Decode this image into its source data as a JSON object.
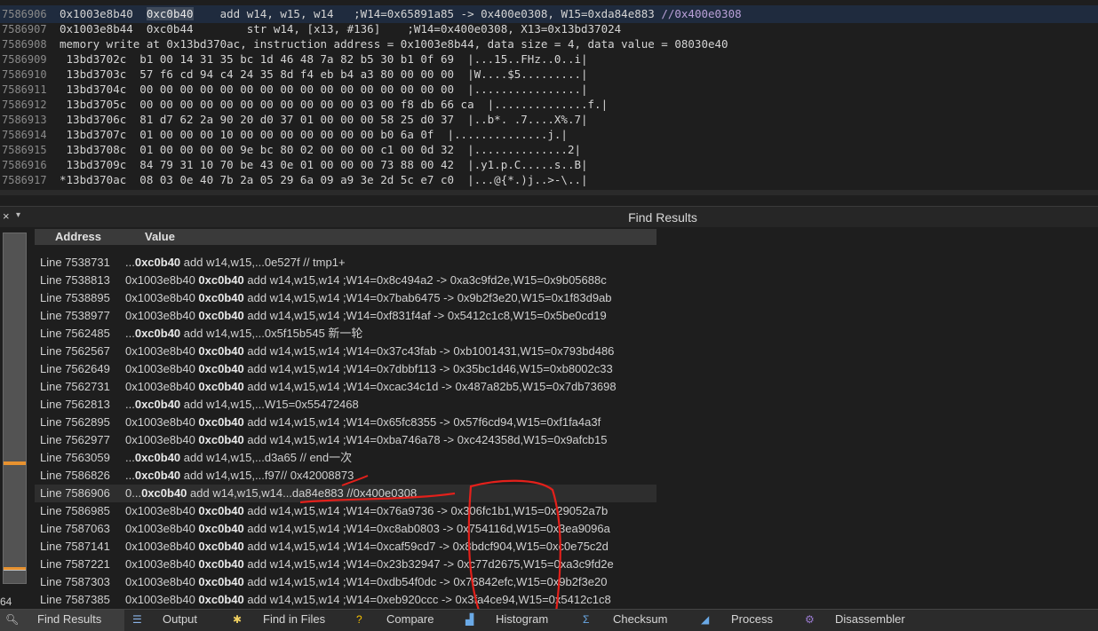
{
  "editor": {
    "lines": [
      {
        "ln": "7586906",
        "segments": [
          {
            "text": "0x1003e8b40  ",
            "cls": ""
          },
          {
            "text": "0xc0b40",
            "cls": "sel"
          },
          {
            "text": "    add w14, w15, w14   ;W14=0x65891a85 -> 0x400e0308, W15=0xda84e883 ",
            "cls": ""
          },
          {
            "text": "//0x400e0308",
            "cls": "cmt"
          }
        ],
        "highlight": true
      },
      {
        "ln": "7586907",
        "segments": [
          {
            "text": "0x1003e8b44  0xc0b44        str w14, [x13, #136]    ;W14=0x400e0308, X13=0x13bd37024",
            "cls": ""
          }
        ]
      },
      {
        "ln": "7586908",
        "segments": [
          {
            "text": "memory write at 0x13bd370ac, instruction address = 0x1003e8b44, data size = 4, data value = 08030e40",
            "cls": ""
          }
        ]
      },
      {
        "ln": "7586909",
        "segments": [
          {
            "text": " 13bd3702c  b1 00 14 31 35 bc 1d 46 48 7a 82 b5 30 b1 0f 69  |...15..FHz..0..i|",
            "cls": ""
          }
        ]
      },
      {
        "ln": "7586910",
        "segments": [
          {
            "text": " 13bd3703c  57 f6 cd 94 c4 24 35 8d f4 eb b4 a3 80 00 00 00  |W....$5.........|",
            "cls": ""
          }
        ]
      },
      {
        "ln": "7586911",
        "segments": [
          {
            "text": " 13bd3704c  00 00 00 00 00 00 00 00 00 00 00 00 00 00 00 00  |................|",
            "cls": ""
          }
        ]
      },
      {
        "ln": "7586912",
        "segments": [
          {
            "text": " 13bd3705c  00 00 00 00 00 00 00 00 00 00 00 03 00 f8 db 66 ca  |..............f.|",
            "cls": ""
          }
        ]
      },
      {
        "ln": "7586913",
        "segments": [
          {
            "text": " 13bd3706c  81 d7 62 2a 90 20 d0 37 01 00 00 00 58 25 d0 37  |..b*. .7....X%.7|",
            "cls": ""
          }
        ]
      },
      {
        "ln": "7586914",
        "segments": [
          {
            "text": " 13bd3707c  01 00 00 00 10 00 00 00 00 00 00 00 b0 6a 0f  |..............j.|",
            "cls": ""
          }
        ]
      },
      {
        "ln": "7586915",
        "segments": [
          {
            "text": " 13bd3708c  01 00 00 00 00 9e bc 80 02 00 00 00 c1 00 0d 32  |..............2|",
            "cls": ""
          }
        ]
      },
      {
        "ln": "7586916",
        "segments": [
          {
            "text": " 13bd3709c  84 79 31 10 70 be 43 0e 01 00 00 00 73 88 00 42  |.y1.p.C.....s..B|",
            "cls": ""
          }
        ]
      },
      {
        "ln": "7586917",
        "segments": [
          {
            "text": "*13bd370ac  08 03 0e 40 7b 2a 05 29 6a 09 a9 3e 2d 5c e7 c0  |...@{*.)j..>-\\..|",
            "cls": ""
          }
        ]
      }
    ]
  },
  "panel": {
    "close_icon": "×",
    "menu_icon": "▾",
    "title": "Find Results",
    "col_address": "Address",
    "col_value": "Value",
    "gutter_number": "64"
  },
  "results": [
    {
      "line": "Line 7538731",
      "pre": "...",
      "bold": "0xc0b40",
      "post": "  add w14,w15,...0e527f  // tmp1+"
    },
    {
      "line": "Line 7538813",
      "pre": "0x1003e8b40  ",
      "bold": "0xc0b40",
      "post": "  add w14,w15,w14 ;W14=0x8c494a2 -> 0xa3c9fd2e,W15=0x9b05688c"
    },
    {
      "line": "Line 7538895",
      "pre": "0x1003e8b40  ",
      "bold": "0xc0b40",
      "post": "  add w14,w15,w14 ;W14=0x7bab6475 -> 0x9b2f3e20,W15=0x1f83d9ab"
    },
    {
      "line": "Line 7538977",
      "pre": "0x1003e8b40  ",
      "bold": "0xc0b40",
      "post": "  add w14,w15,w14 ;W14=0xf831f4af -> 0x5412c1c8,W15=0x5be0cd19"
    },
    {
      "line": "Line 7562485",
      "pre": "...",
      "bold": "0xc0b40",
      "post": "  add w14,w15,...0x5f15b545 新一轮"
    },
    {
      "line": "Line 7562567",
      "pre": "0x1003e8b40  ",
      "bold": "0xc0b40",
      "post": "  add w14,w15,w14 ;W14=0x37c43fab -> 0xb1001431,W15=0x793bd486"
    },
    {
      "line": "Line 7562649",
      "pre": "0x1003e8b40  ",
      "bold": "0xc0b40",
      "post": "  add w14,w15,w14 ;W14=0x7dbbf113 -> 0x35bc1d46,W15=0xb8002c33"
    },
    {
      "line": "Line 7562731",
      "pre": "0x1003e8b40  ",
      "bold": "0xc0b40",
      "post": "  add w14,w15,w14 ;W14=0xcac34c1d -> 0x487a82b5,W15=0x7db73698"
    },
    {
      "line": "Line 7562813",
      "pre": "...",
      "bold": "0xc0b40",
      "post": "  add w14,w15,...W15=0x55472468"
    },
    {
      "line": "Line 7562895",
      "pre": "0x1003e8b40  ",
      "bold": "0xc0b40",
      "post": "  add w14,w15,w14 ;W14=0x65fc8355 -> 0x57f6cd94,W15=0xf1fa4a3f"
    },
    {
      "line": "Line 7562977",
      "pre": "0x1003e8b40  ",
      "bold": "0xc0b40",
      "post": "  add w14,w15,w14 ;W14=0xba746a78 -> 0xc424358d,W15=0x9afcb15"
    },
    {
      "line": "Line 7563059",
      "pre": "...",
      "bold": "0xc0b40",
      "post": "  add w14,w15,...d3a65 // end一次"
    },
    {
      "line": "Line 7586826",
      "pre": "...",
      "bold": "0xc0b40",
      "post": "  add w14,w15,...f97// 0x42008873"
    },
    {
      "line": "Line 7586906",
      "pre": "0...",
      "bold": "0xc0b40",
      "post": "   add w14,w15,w14...da84e883 //0x400e0308",
      "selected": true
    },
    {
      "line": "Line 7586985",
      "pre": "0x1003e8b40  ",
      "bold": "0xc0b40",
      "post": "  add w14,w15,w14 ;W14=0x76a9736 -> 0x306fc1b1,W15=0x29052a7b"
    },
    {
      "line": "Line 7587063",
      "pre": "0x1003e8b40  ",
      "bold": "0xc0b40",
      "post": "  add w14,w15,w14 ;W14=0xc8ab0803 -> 0x754116d,W15=0x3ea9096a"
    },
    {
      "line": "Line 7587141",
      "pre": "0x1003e8b40  ",
      "bold": "0xc0b40",
      "post": "  add w14,w15,w14 ;W14=0xcaf59cd7 -> 0x8bdcf904,W15=0xc0e75c2d"
    },
    {
      "line": "Line 7587221",
      "pre": "0x1003e8b40  ",
      "bold": "0xc0b40",
      "post": "  add w14,w15,w14 ;W14=0x23b32947 -> 0xc77d2675,W15=0xa3c9fd2e"
    },
    {
      "line": "Line 7587303",
      "pre": "0x1003e8b40  ",
      "bold": "0xc0b40",
      "post": "  add w14,w15,w14 ;W14=0xdb54f0dc -> 0x76842efc,W15=0x9b2f3e20"
    },
    {
      "line": "Line 7587385",
      "pre": "0x1003e8b40  ",
      "bold": "0xc0b40",
      "post": "  add w14,w15,w14 ;W14=0xeb920ccc -> 0x3fa4ce94,W15=0x5412c1c8"
    }
  ],
  "tabs": [
    {
      "id": "find-results",
      "label": "Find Results",
      "icon": "magnifier-icon",
      "active": true
    },
    {
      "id": "output",
      "label": "Output",
      "icon": "output-list-icon"
    },
    {
      "id": "find-in-files",
      "label": "Find in Files",
      "icon": "find-in-files-icon"
    },
    {
      "id": "compare",
      "label": "Compare",
      "icon": "question-compare-icon"
    },
    {
      "id": "histogram",
      "label": "Histogram",
      "icon": "histogram-icon"
    },
    {
      "id": "checksum",
      "label": "Checksum",
      "icon": "sigma-icon"
    },
    {
      "id": "process",
      "label": "Process",
      "icon": "process-icon"
    },
    {
      "id": "disassembler",
      "label": "Disassembler",
      "icon": "disassembler-icon"
    }
  ],
  "colors": {
    "selection_mark": "#e8922f",
    "annotation_red": "#e3201b",
    "comment": "#b9a0d8"
  }
}
